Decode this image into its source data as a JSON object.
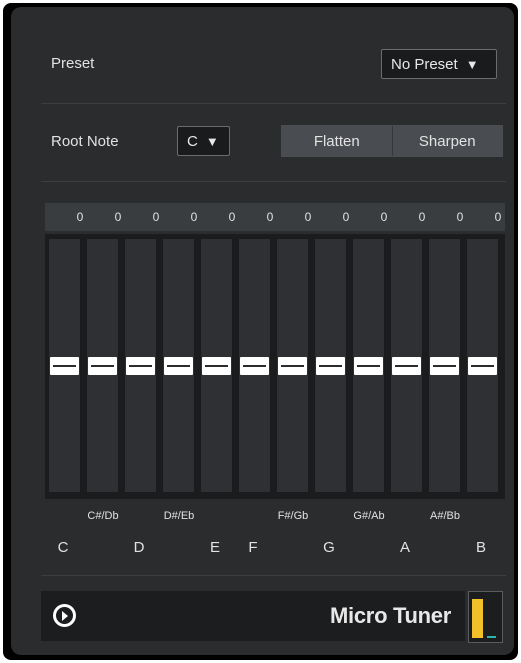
{
  "preset": {
    "label": "Preset",
    "value": "No Preset",
    "caret": "▼"
  },
  "root": {
    "label": "Root Note",
    "value": "C",
    "caret": "▼"
  },
  "buttons": {
    "flatten": "Flatten",
    "sharpen": "Sharpen"
  },
  "offsets": [
    "0",
    "0",
    "0",
    "0",
    "0",
    "0",
    "0",
    "0",
    "0",
    "0",
    "0",
    "0"
  ],
  "slider_levels": [
    0.5,
    0.5,
    0.5,
    0.5,
    0.5,
    0.5,
    0.5,
    0.5,
    0.5,
    0.5,
    0.5,
    0.5
  ],
  "notes_sharp": [
    "C#/Db",
    "D#/Eb",
    "F#/Gb",
    "G#/Ab",
    "A#/Bb"
  ],
  "notes_natural": [
    "C",
    "D",
    "E",
    "F",
    "G",
    "A",
    "B"
  ],
  "footer": {
    "plugin_name": "Micro Tuner",
    "power_icon": "power-icon"
  },
  "meter": {
    "level": 0.85,
    "colors": {
      "main": "#f2c029",
      "side": "#2bb5ac"
    }
  }
}
